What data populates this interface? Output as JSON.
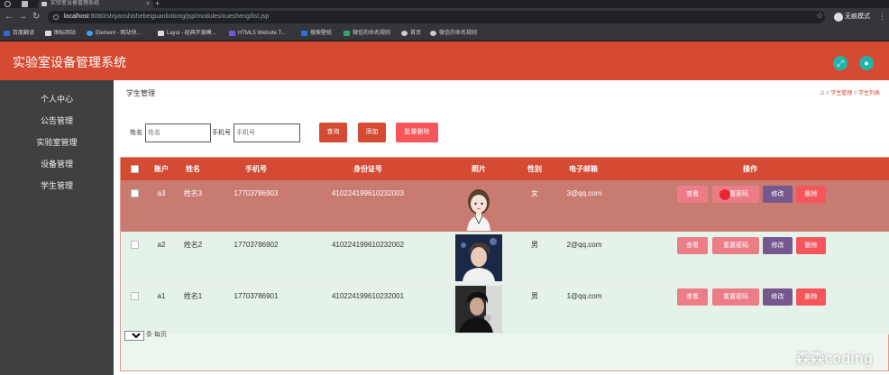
{
  "browser": {
    "tab_title": "实验室设备管理系统",
    "url_host": "localhost",
    "url_rest": ":8080/shiyanshishebeiguanlixitong/jsp/modules/xuesheng/list.jsp",
    "profile_label": "无痕模式",
    "bookmarks": [
      {
        "label": "百度翻译",
        "icon": "baidu-icon",
        "color": "#3666d6"
      },
      {
        "label": "图标网站",
        "icon": "flag-icon",
        "color": "#dddddd"
      },
      {
        "label": "Element - 网站快...",
        "icon": "element-icon",
        "color": "#409eff"
      },
      {
        "label": "Layui - 经典开源模...",
        "icon": "layui-icon",
        "color": "#dddddd"
      },
      {
        "label": "HTML5 Website T...",
        "icon": "html5-icon",
        "color": "#6f5bd8"
      },
      {
        "label": "搜索壁纸",
        "icon": "wallpaper-icon",
        "color": "#2d6ee0"
      },
      {
        "label": "微信的命名规则",
        "icon": "wechat-icon",
        "color": "#2aa86a"
      },
      {
        "label": "首页",
        "icon": "globe-icon",
        "color": "#cccccc"
      },
      {
        "label": "微信的命名规则",
        "icon": "globe-icon",
        "color": "#cccccc"
      }
    ]
  },
  "app": {
    "title": "实验室设备管理系统",
    "header_icons": [
      "fullscreen-icon",
      "user-icon"
    ],
    "sidebar": [
      "个人中心",
      "公告管理",
      "实验室管理",
      "设备管理",
      "学生管理"
    ]
  },
  "page": {
    "title": "学生管理",
    "breadcrumb": [
      "学生管理",
      "学生列表"
    ],
    "filter": {
      "name_label": "姓名",
      "name_placeholder": "姓名",
      "phone_label": "手机号",
      "phone_placeholder": "手机号",
      "query": "查询",
      "add": "添加",
      "batch_delete": "批量删除"
    }
  },
  "table": {
    "headers": [
      "账户",
      "姓名",
      "手机号",
      "身份证号",
      "照片",
      "性别",
      "电子邮箱",
      "操作"
    ],
    "rows": [
      {
        "account": "a3",
        "name": "姓名3",
        "phone": "17703786903",
        "id_card": "410224199610232003",
        "gender": "女",
        "email": "3@qq.com"
      },
      {
        "account": "a2",
        "name": "姓名2",
        "phone": "17703786902",
        "id_card": "410224199610232002",
        "gender": "男",
        "email": "2@qq.com"
      },
      {
        "account": "a1",
        "name": "姓名1",
        "phone": "17703786901",
        "id_card": "410224199610232001",
        "gender": "男",
        "email": "1@qq.com"
      }
    ],
    "actions": {
      "view": "查看",
      "reset": "重置密码",
      "edit": "修改",
      "delete": "删除"
    }
  },
  "pager": {
    "page_size": "10",
    "suffix": "条 每页"
  },
  "watermark": "森森coding",
  "colors": {
    "primary": "#d44a32",
    "teal": "#1fb5ac",
    "sidebar": "#3f4042",
    "pink": "#ec7d87",
    "purple": "#76588f",
    "red_btn": "#f5565b"
  }
}
